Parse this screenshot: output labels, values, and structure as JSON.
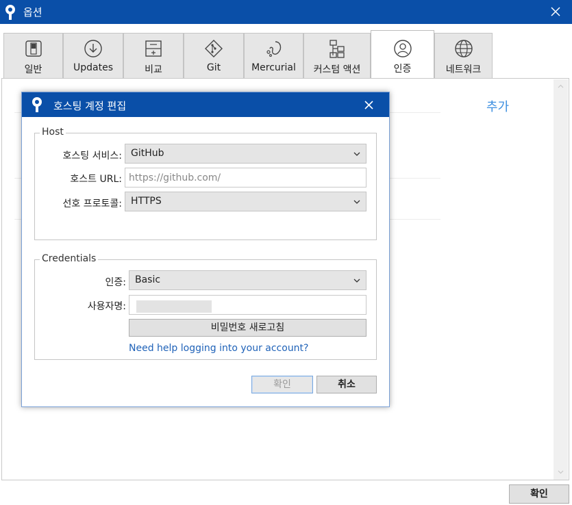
{
  "window": {
    "title": "옵션",
    "icon": "sourcetree-logo-icon"
  },
  "tabs": [
    {
      "label": "일반",
      "icon": "switch-icon"
    },
    {
      "label": "Updates",
      "icon": "download-circle-icon"
    },
    {
      "label": "비교",
      "icon": "diff-icon"
    },
    {
      "label": "Git",
      "icon": "git-diamond-icon"
    },
    {
      "label": "Mercurial",
      "icon": "mercurial-drop-icon"
    },
    {
      "label": "커스텀 액션",
      "icon": "hierarchy-icon"
    },
    {
      "label": "인증",
      "icon": "user-circle-icon",
      "active": true
    },
    {
      "label": "네트워크",
      "icon": "globe-icon"
    }
  ],
  "panel": {
    "add_label": "추가"
  },
  "footer": {
    "ok_label": "확인"
  },
  "dialog": {
    "title": "호스팅 계정 편집",
    "host_group": {
      "legend": "Host",
      "service_label": "호스팅 서비스:",
      "service_value": "GitHub",
      "url_label": "호스트 URL:",
      "url_placeholder": "https://github.com/",
      "protocol_label": "선호 프로토콜:",
      "protocol_value": "HTTPS"
    },
    "credentials_group": {
      "legend": "Credentials",
      "auth_label": "인증:",
      "auth_value": "Basic",
      "username_label": "사용자명:",
      "refresh_password_label": "비밀번호 새로고침",
      "help_link": "Need help logging into your account?"
    },
    "ok_label": "확인",
    "cancel_label": "취소"
  },
  "colors": {
    "titlebar": "#0a4fa8",
    "link": "#1f62b8",
    "add_link": "#3b8ee0"
  }
}
